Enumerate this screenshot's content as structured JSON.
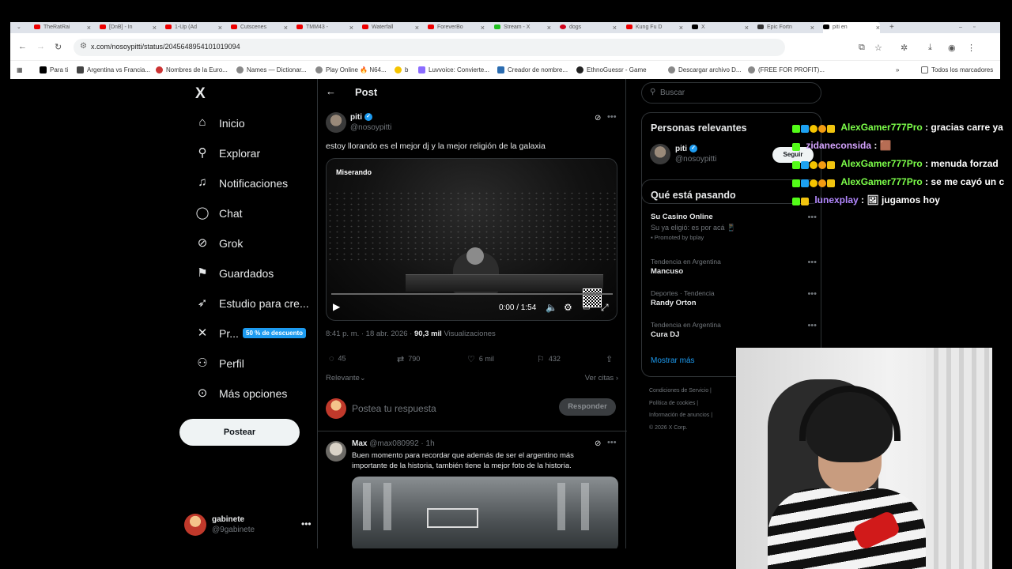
{
  "browser": {
    "tabs": [
      {
        "label": "TheRatRai"
      },
      {
        "label": "[DnB] - In"
      },
      {
        "label": "1-Up (Ad"
      },
      {
        "label": "Cutscenes"
      },
      {
        "label": "TMM43 -"
      },
      {
        "label": "Waterfall"
      },
      {
        "label": "ForeverBo"
      },
      {
        "label": "Stream - X"
      },
      {
        "label": "dogs"
      },
      {
        "label": "Kung Fu D"
      },
      {
        "label": "X"
      },
      {
        "label": "Epic Fortn"
      },
      {
        "label": "piti en"
      }
    ],
    "url": "x.com/nosoypitti/status/2045648954101019094",
    "bookmarks": [
      "Para ti",
      "Argentina vs Francia...",
      "Nombres de la Euro...",
      "Names — Dictionar...",
      "Play Online 🔥 N64...",
      "b",
      "Luvvoice: Convierte...",
      "Creador de nombre...",
      "EthnoGuessr - Game",
      "Descargar archivo D...",
      "(FREE FOR PROFIT)...",
      "Todos los marcadores"
    ]
  },
  "sidenav": {
    "logo": "X",
    "items": [
      {
        "label": "Inicio"
      },
      {
        "label": "Explorar"
      },
      {
        "label": "Notificaciones"
      },
      {
        "label": "Chat"
      },
      {
        "label": "Grok"
      },
      {
        "label": "Guardados"
      },
      {
        "label": "Estudio para cre..."
      },
      {
        "label": "Pr..."
      },
      {
        "label": "Perfil"
      },
      {
        "label": "Más opciones"
      }
    ],
    "premium_badge": "50 % de descuento",
    "post_button": "Postear",
    "account": {
      "name": "gabinete",
      "handle": "@9gabinete"
    }
  },
  "main": {
    "header_title": "Post",
    "tweet": {
      "author_name": "piti",
      "author_handle": "@nosoypitti",
      "text": "estoy llorando es el mejor dj y la mejor religión de la galaxia",
      "video_watermark": "Miserando",
      "video_time": "0:00 / 1:54",
      "timestamp": "8:41 p. m. · 18 abr. 2026 ·",
      "views_count": "90,3 mil",
      "views_label": "Visualizaciones",
      "replies": "45",
      "reposts": "790",
      "likes": "6 mil",
      "bookmarks": "432",
      "sort_label": "Relevante",
      "quotes_label": "Ver citas"
    },
    "reply_placeholder": "Postea tu respuesta",
    "reply_button": "Responder",
    "first_reply": {
      "name": "Max",
      "handle_time": "@max080992 · 1h",
      "text": "Buen momento para recordar que además de ser el argentino más importante de la historia, también tiene la mejor foto de la historia."
    }
  },
  "right": {
    "search_placeholder": "Buscar",
    "relevant_title": "Personas relevantes",
    "relevant_person": {
      "name": "piti",
      "handle": "@nosoypitti",
      "follow": "Seguir"
    },
    "trending_title": "Qué está pasando",
    "promo": {
      "title": "Su Casino Online",
      "subtitle": "Su ya eligió: es por acá 📱",
      "promoted": "Promoted by bplay"
    },
    "trends": [
      {
        "context": "Tendencia en Argentina",
        "topic": "Mancuso"
      },
      {
        "context": "Deportes · Tendencia",
        "topic": "Randy Orton"
      },
      {
        "context": "Tendencia en Argentina",
        "topic": "Cura DJ"
      }
    ],
    "show_more": "Mostrar más",
    "footer": [
      "Condiciones de Servicio |",
      "Política de cookies |",
      "Información de anuncios |",
      "© 2026 X Corp."
    ]
  },
  "chat": [
    {
      "user": "AlexGamer777Pro",
      "message": ": gracias carre ya",
      "color": "#7dff4a"
    },
    {
      "user": "zidaneconsida",
      "message": ": 🟫",
      "color": "#d6a4ff"
    },
    {
      "user": "AlexGamer777Pro",
      "message": ": menuda forzad",
      "color": "#7dff4a"
    },
    {
      "user": "AlexGamer777Pro",
      "message": ": se me cayó un c",
      "color": "#7dff4a"
    },
    {
      "user": "lunexplay",
      "message": ": 🖼 jugamos hoy",
      "color": "#b388ff"
    }
  ],
  "colors": {
    "accent": "#1d9bf0",
    "background": "#000000"
  }
}
